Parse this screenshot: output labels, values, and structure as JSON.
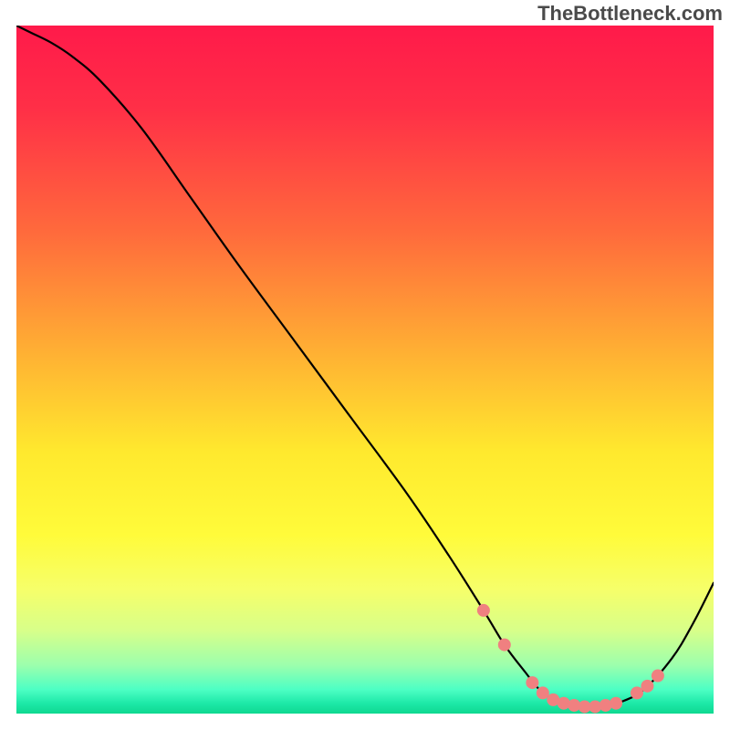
{
  "watermark": "TheBottleneck.com",
  "chart_data": {
    "type": "line",
    "title": "",
    "xlabel": "",
    "ylabel": "",
    "xlim": [
      0,
      100
    ],
    "ylim": [
      0,
      100
    ],
    "series": [
      {
        "name": "curve",
        "x": [
          0,
          2,
          5,
          8,
          12,
          18,
          25,
          32,
          40,
          48,
          56,
          62,
          67,
          70,
          73,
          75,
          77,
          79,
          81,
          83,
          85,
          87,
          90,
          94,
          97,
          100
        ],
        "y": [
          100,
          99,
          97.5,
          95.5,
          92,
          85,
          75,
          65,
          54,
          43,
          32,
          23,
          15,
          10,
          6,
          3.5,
          2,
          1.2,
          1,
          1,
          1.2,
          1.8,
          3.5,
          8,
          13,
          19
        ]
      }
    ],
    "dots": {
      "name": "dots",
      "x": [
        67,
        70,
        74,
        75.5,
        77,
        78.5,
        80,
        81.5,
        83,
        84.5,
        86,
        89,
        90.5,
        92
      ],
      "y": [
        15,
        10,
        4.5,
        3,
        2,
        1.5,
        1.2,
        1,
        1,
        1.2,
        1.5,
        3,
        4,
        5.5
      ]
    },
    "gradient_stops": [
      {
        "offset": 0,
        "color": "#ff1a4a"
      },
      {
        "offset": 0.12,
        "color": "#ff2f47"
      },
      {
        "offset": 0.3,
        "color": "#ff6a3c"
      },
      {
        "offset": 0.48,
        "color": "#ffb233"
      },
      {
        "offset": 0.62,
        "color": "#ffe92e"
      },
      {
        "offset": 0.74,
        "color": "#fffb3a"
      },
      {
        "offset": 0.82,
        "color": "#f6ff6a"
      },
      {
        "offset": 0.88,
        "color": "#d7ff8a"
      },
      {
        "offset": 0.93,
        "color": "#9cffad"
      },
      {
        "offset": 0.965,
        "color": "#4dffc4"
      },
      {
        "offset": 0.985,
        "color": "#1de9a8"
      },
      {
        "offset": 1.0,
        "color": "#0fd890"
      }
    ],
    "dot_color": "#f08080",
    "line_color": "#000000",
    "line_width": 2.2,
    "dot_radius": 7
  }
}
